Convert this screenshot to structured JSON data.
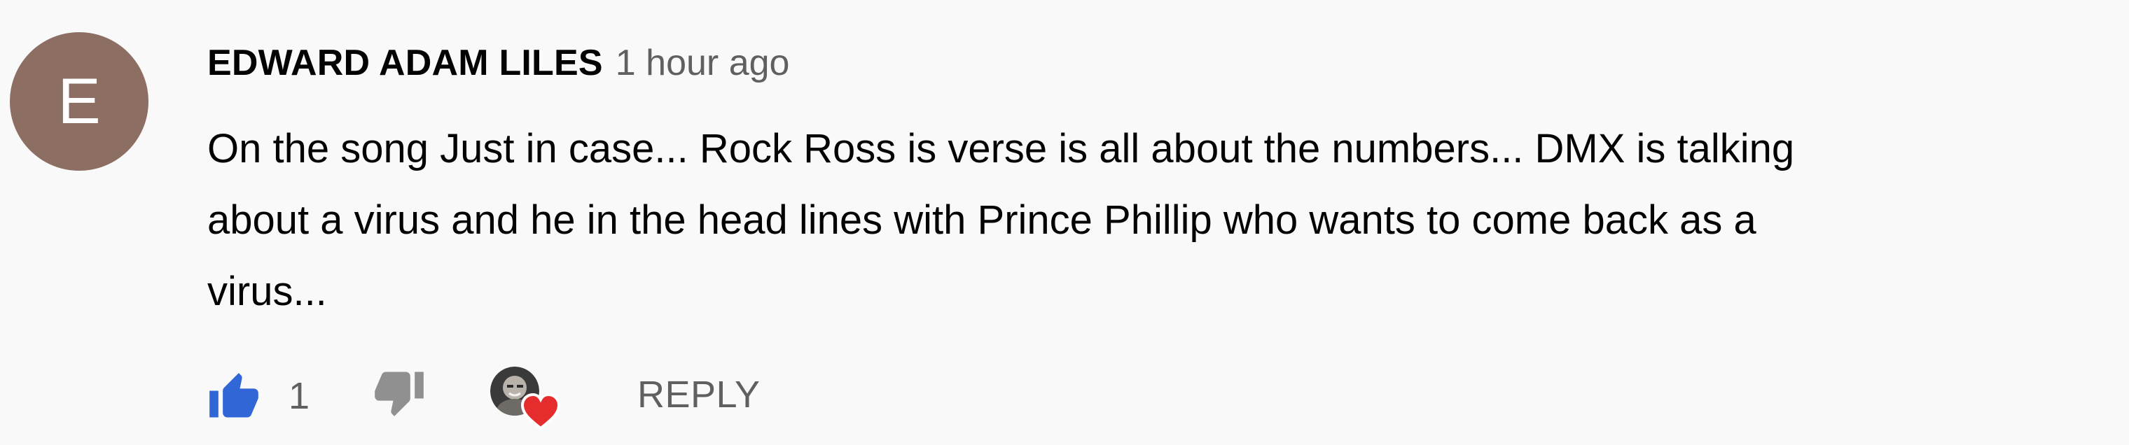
{
  "comment": {
    "avatar": {
      "initial": "E",
      "color": "#8d6e63"
    },
    "author": "EDWARD ADAM LILES",
    "timestamp": "1 hour ago",
    "text_lines": [
      "On the song Just in case... Rock Ross is verse is all about the numbers... DMX is talking",
      "about a virus and he in the head lines with Prince Phillip who wants to come back as a",
      "virus..."
    ]
  },
  "actions": {
    "like_icon": "thumb-up-icon",
    "like_color": "#3066d6",
    "like_count": "1",
    "dislike_icon": "thumb-down-icon",
    "creator_heart": {
      "icon": "heart-icon",
      "color": "#e62d2d"
    },
    "reply_label": "REPLY"
  }
}
